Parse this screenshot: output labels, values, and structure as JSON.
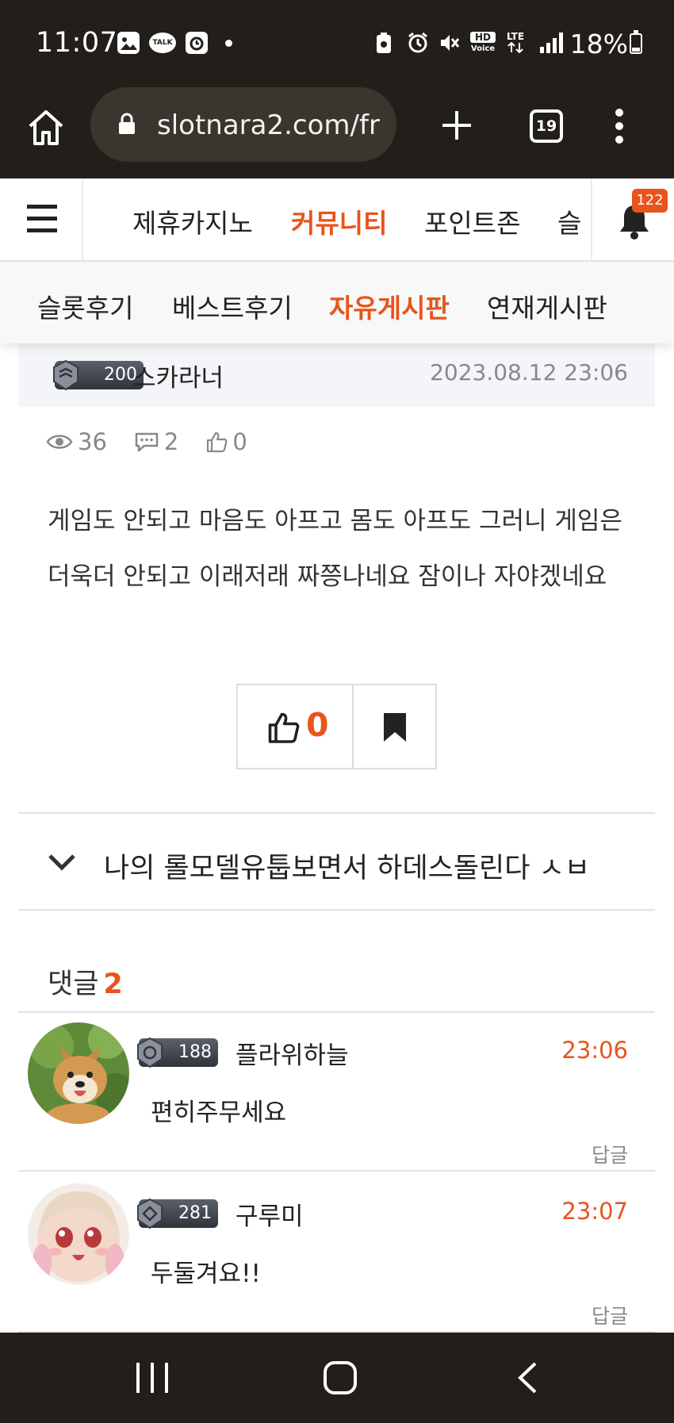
{
  "status_bar": {
    "time": "11:07",
    "talk_label": "TALK",
    "hd_label": "HD",
    "voice_label": "Voice",
    "lte_label": "LTE",
    "battery_percent": "18%"
  },
  "browser": {
    "url": "slotnara2.com/fr",
    "tab_count": "19"
  },
  "site_nav": {
    "items": [
      {
        "label": "제휴카지노",
        "active": false
      },
      {
        "label": "커뮤니티",
        "active": true
      },
      {
        "label": "포인트존",
        "active": false
      },
      {
        "label": "슬",
        "active": false
      }
    ],
    "notification_count": "122"
  },
  "sub_nav": {
    "items": [
      {
        "label": "슬롯후기",
        "active": false
      },
      {
        "label": "베스트후기",
        "active": false
      },
      {
        "label": "자유게시판",
        "active": true
      },
      {
        "label": "연재게시판",
        "active": false
      }
    ]
  },
  "post": {
    "author_level": "200",
    "author": "스카라너",
    "date": "2023.08.12 23:06",
    "views": "36",
    "comment_count": "2",
    "likes": "0",
    "body_lines": [
      "게임도 안되고 마음도 아프고 몸도 아프도 그러니 게임은",
      "더욱더 안되고 이래저래 짜쯩나네요 잠이나 자야겠네요"
    ],
    "like_button_count": "0"
  },
  "related": {
    "title": "나의 롤모델유툽보면서 하데스돌린다 ㅅㅂ"
  },
  "comments": {
    "label": "댓글",
    "count": "2",
    "items": [
      {
        "level": "188",
        "author": "플라위하늘",
        "time": "23:06",
        "text": "편히주무세요",
        "reply_label": "답글"
      },
      {
        "level": "281",
        "author": "구루미",
        "time": "23:07",
        "text": "두둘겨요!!",
        "reply_label": "답글"
      }
    ]
  },
  "colors": {
    "accent": "#e8541c",
    "chrome": "#221f1b"
  }
}
